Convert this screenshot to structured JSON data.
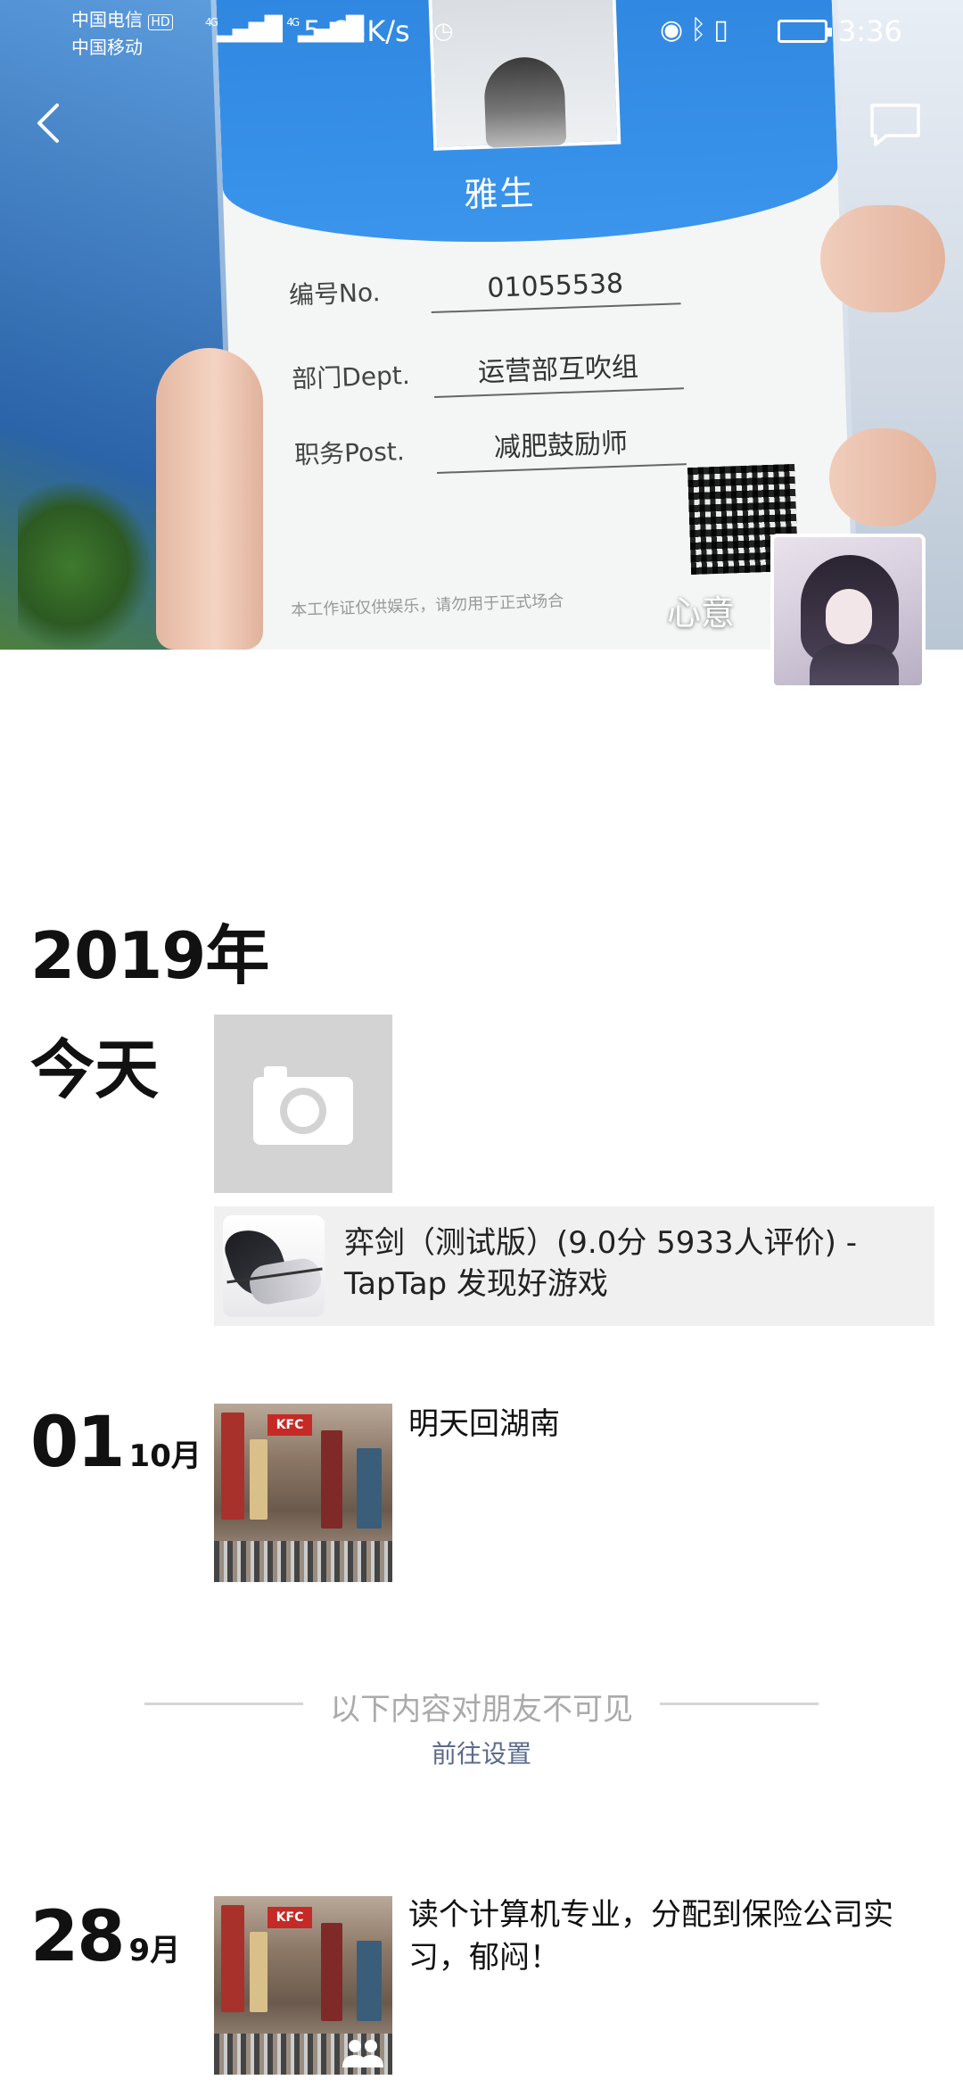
{
  "status_bar": {
    "carrier_1": "中国电信",
    "carrier_1_badge": "HD",
    "carrier_2": "中国移动",
    "net_1": "4G",
    "net_2": "4G",
    "speed": "5.65K/s",
    "time": "3:36"
  },
  "cover_photo": {
    "badge_logo": "雅生",
    "rows": [
      {
        "label": "编号No.",
        "value": "01055538"
      },
      {
        "label": "部门Dept.",
        "value": "运营部互吹组"
      },
      {
        "label": "职务Post.",
        "value": "减肥鼓励师"
      }
    ],
    "footer": "本工作证仅供娱乐，请勿用于正式场合"
  },
  "nav": {
    "back_icon": "back-arrow-icon",
    "message_icon": "message-icon"
  },
  "profile": {
    "name": "心意"
  },
  "timeline": {
    "year": "2019年",
    "today_label": "今天",
    "share_card": {
      "text": "弈剑（测试版）(9.0分 5933人评价) - TapTap 发现好游戏"
    },
    "posts": [
      {
        "day": "01",
        "month": "10月",
        "text": "明天回湖南"
      },
      {
        "day": "28",
        "month": "9月",
        "text": "读个计算机专业，分配到保险公司实习，郁闷！"
      }
    ],
    "visibility_notice": "以下内容对朋友不可见",
    "goto_settings": "前往设置"
  }
}
